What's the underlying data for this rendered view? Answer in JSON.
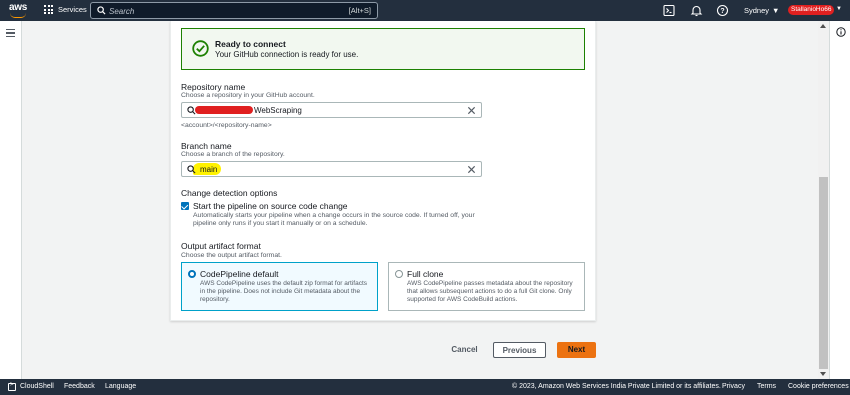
{
  "topbar": {
    "logo": "aws",
    "services": "Services",
    "search_placeholder": "Search",
    "search_shortcut": "[Alt+S]",
    "region": "Sydney",
    "account": "StallanioHo66"
  },
  "success": {
    "title": "Ready to connect",
    "description": "Your GitHub connection is ready for use."
  },
  "repository": {
    "label": "Repository name",
    "description": "Choose a repository in your GitHub account.",
    "value": "WebScraping",
    "hint": "<account>/<repository-name>"
  },
  "branch": {
    "label": "Branch name",
    "description": "Choose a branch of the repository.",
    "value": "main"
  },
  "change_detection": {
    "label": "Change detection options",
    "checkbox_label": "Start the pipeline on source code change",
    "checkbox_desc_1": "Automatically starts your pipeline when a change occurs in the source code. If turned off, your",
    "checkbox_desc_2": "pipeline only runs if you start it manually or on a schedule."
  },
  "output_format": {
    "label": "Output artifact format",
    "description": "Choose the output artifact format.",
    "options": [
      {
        "title": "CodePipeline default",
        "description": "AWS CodePipeline uses the default zip format for artifacts in the pipeline. Does not include Git metadata about the repository.",
        "selected": true
      },
      {
        "title": "Full clone",
        "description": "AWS CodePipeline passes metadata about the repository that allows subsequent actions to do a full Git clone. Only supported for AWS CodeBuild actions.",
        "selected": false
      }
    ]
  },
  "actions": {
    "cancel": "Cancel",
    "previous": "Previous",
    "next": "Next"
  },
  "footer": {
    "cloudshell": "CloudShell",
    "feedback": "Feedback",
    "language": "Language",
    "copyright": "© 2023, Amazon Web Services India Private Limited or its affiliates.",
    "privacy": "Privacy",
    "terms": "Terms",
    "cookies": "Cookie preferences"
  },
  "colors": {
    "nav_bg": "#232f3e",
    "success_green": "#1d8102",
    "primary_orange": "#ec7211",
    "link_blue": "#0073bb"
  }
}
